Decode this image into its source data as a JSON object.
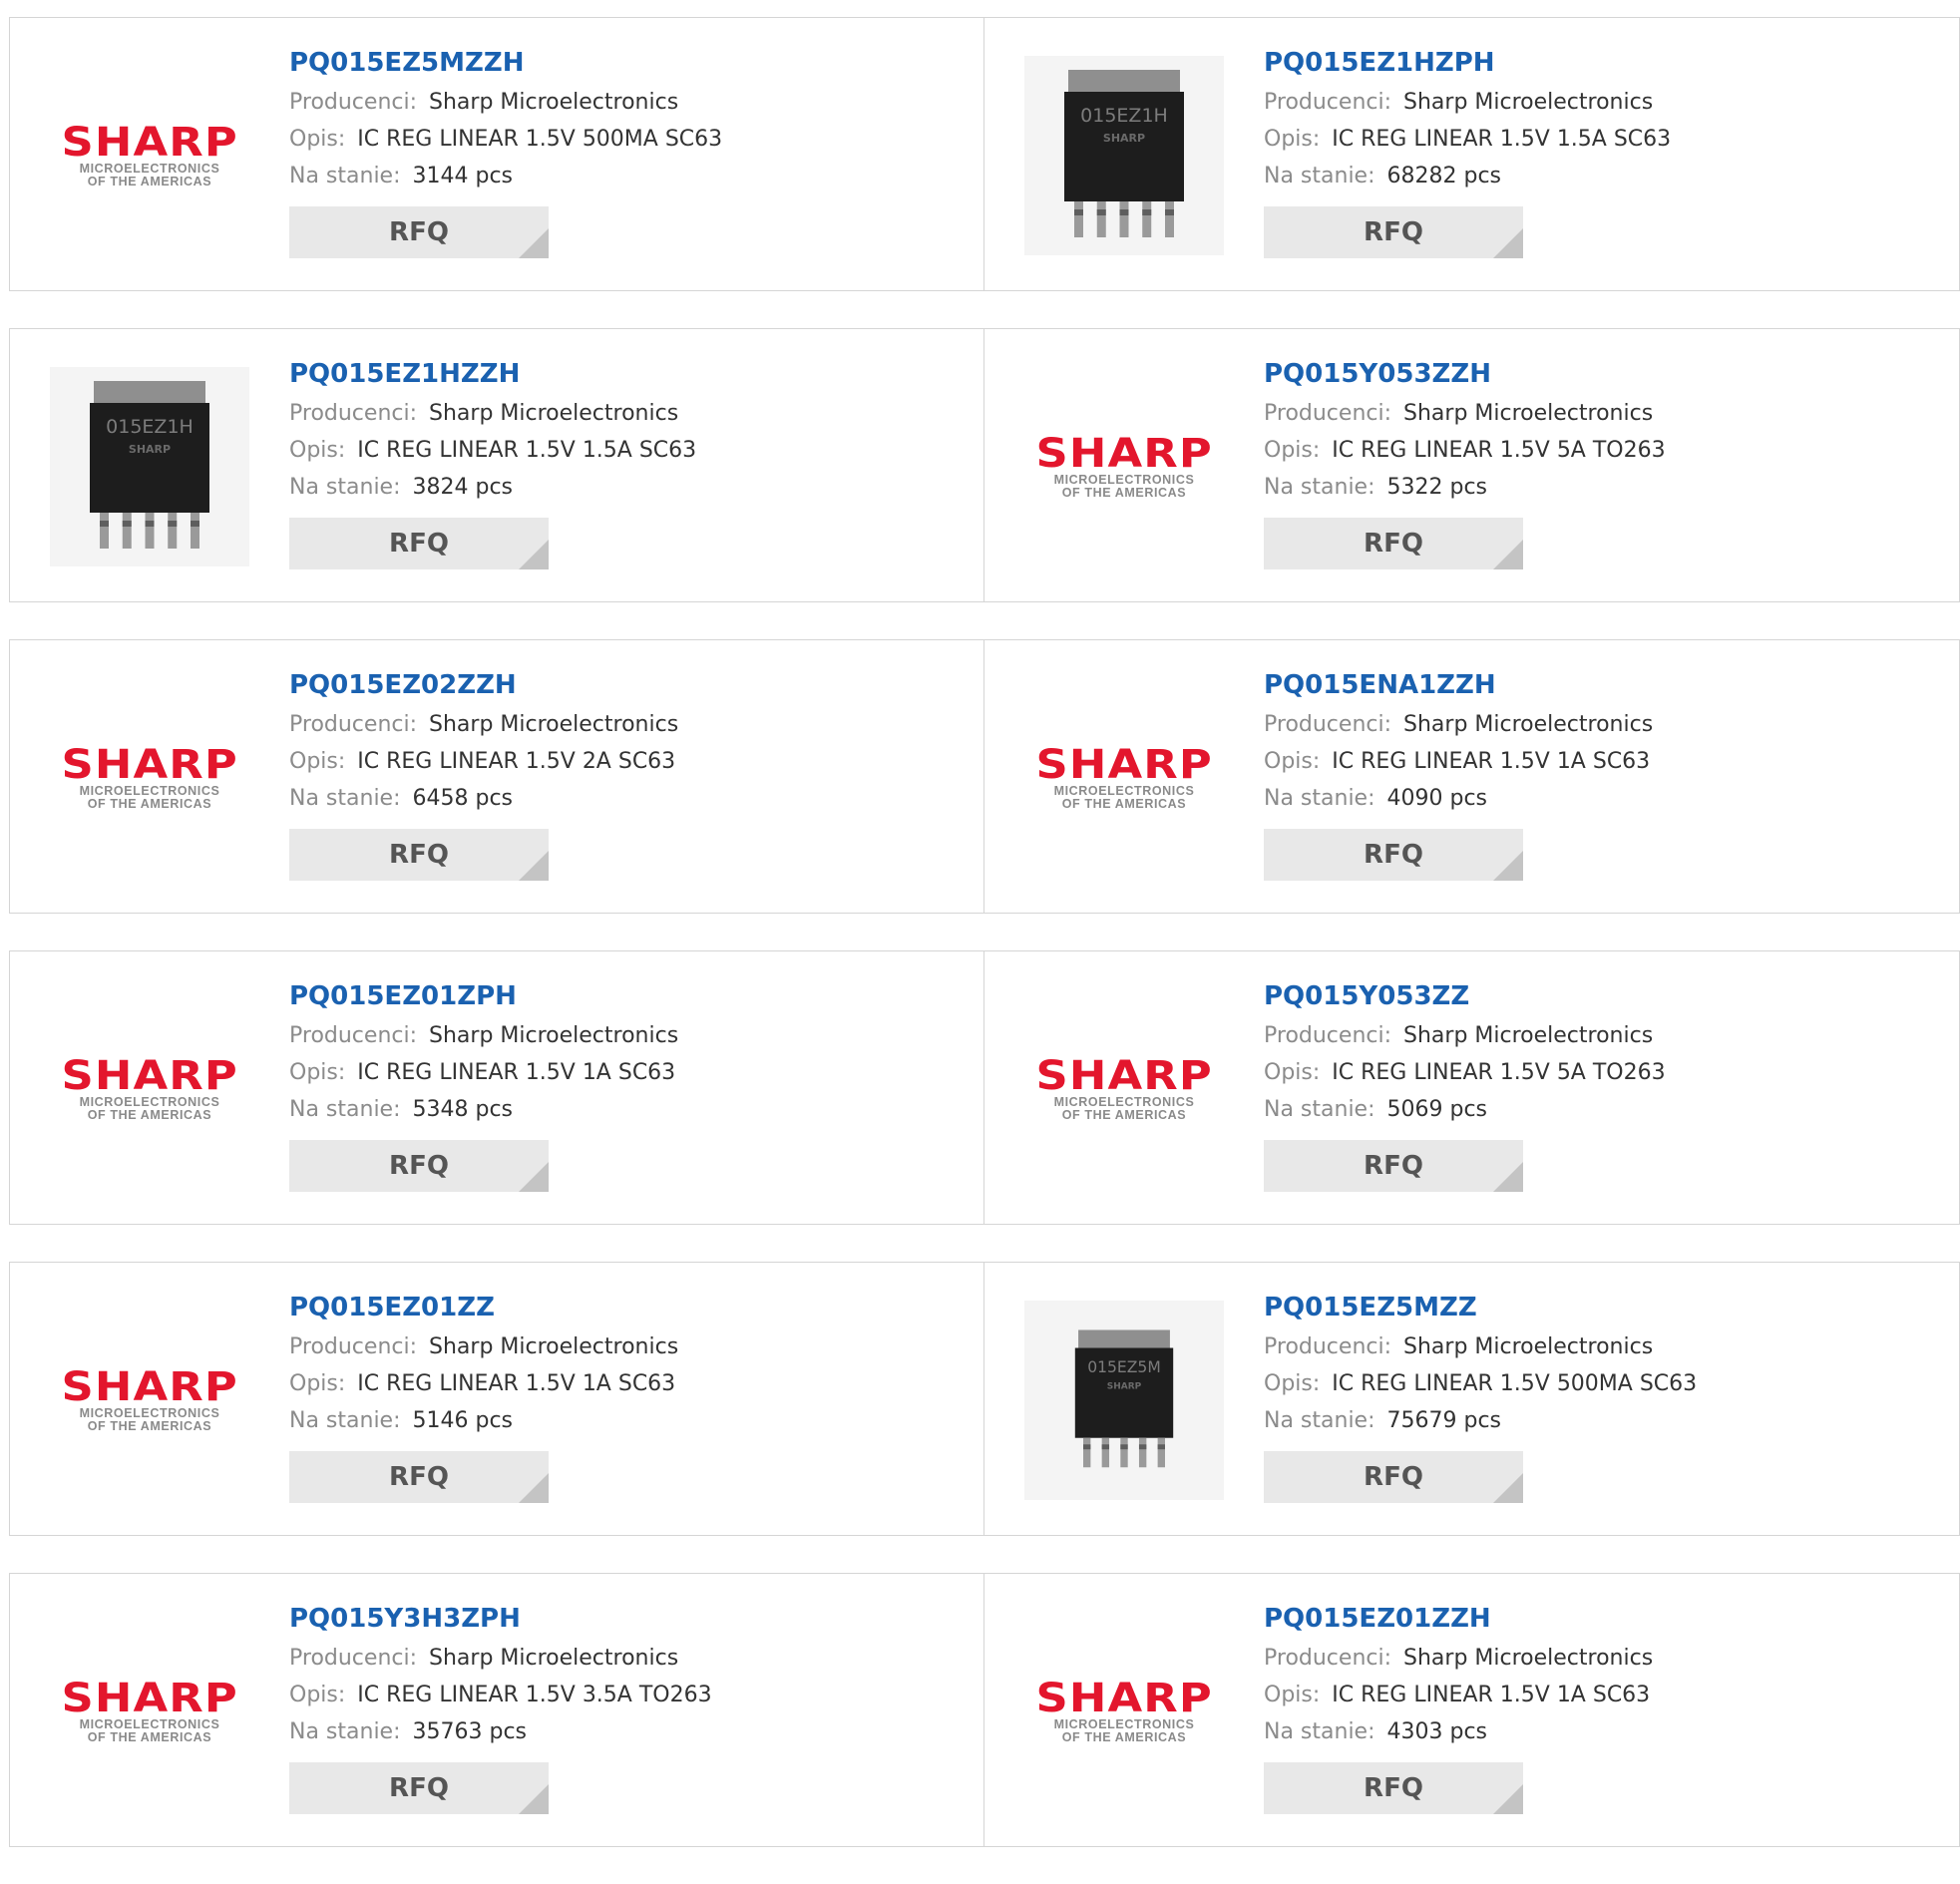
{
  "labels": {
    "manufacturer": "Producenci:",
    "description": "Opis:",
    "stock": "Na stanie:",
    "rfq": "RFQ"
  },
  "logo": {
    "word": "SHARP",
    "line1": "MICROELECTRONICS",
    "line2": "OF THE AMERICAS"
  },
  "colors": {
    "part_link": "#1a61b0",
    "logo_red": "#e3162d",
    "label_gray": "#8b8b8b",
    "button_bg": "#e8e8e8"
  },
  "products": [
    {
      "part": "PQ015EZ5MZZH",
      "manufacturer": "Sharp Microelectronics",
      "description": "IC REG LINEAR 1.5V 500MA SC63",
      "stock": "3144 pcs",
      "image": "logo"
    },
    {
      "part": "PQ015EZ1HZPH",
      "manufacturer": "Sharp Microelectronics",
      "description": "IC REG LINEAR 1.5V 1.5A SC63",
      "stock": "68282 pcs",
      "image": "chip",
      "chip_text": "015EZ1H"
    },
    {
      "part": "PQ015EZ1HZZH",
      "manufacturer": "Sharp Microelectronics",
      "description": "IC REG LINEAR 1.5V 1.5A SC63",
      "stock": "3824 pcs",
      "image": "chip",
      "chip_text": "015EZ1H"
    },
    {
      "part": "PQ015Y053ZZH",
      "manufacturer": "Sharp Microelectronics",
      "description": "IC REG LINEAR 1.5V 5A TO263",
      "stock": "5322 pcs",
      "image": "logo"
    },
    {
      "part": "PQ015EZ02ZZH",
      "manufacturer": "Sharp Microelectronics",
      "description": "IC REG LINEAR 1.5V 2A SC63",
      "stock": "6458 pcs",
      "image": "logo"
    },
    {
      "part": "PQ015ENA1ZZH",
      "manufacturer": "Sharp Microelectronics",
      "description": "IC REG LINEAR 1.5V 1A SC63",
      "stock": "4090 pcs",
      "image": "logo"
    },
    {
      "part": "PQ015EZ01ZPH",
      "manufacturer": "Sharp Microelectronics",
      "description": "IC REG LINEAR 1.5V 1A SC63",
      "stock": "5348 pcs",
      "image": "logo"
    },
    {
      "part": "PQ015Y053ZZ",
      "manufacturer": "Sharp Microelectronics",
      "description": "IC REG LINEAR 1.5V 5A TO263",
      "stock": "5069 pcs",
      "image": "logo"
    },
    {
      "part": "PQ015EZ01ZZ",
      "manufacturer": "Sharp Microelectronics",
      "description": "IC REG LINEAR 1.5V 1A SC63",
      "stock": "5146 pcs",
      "image": "logo"
    },
    {
      "part": "PQ015EZ5MZZ",
      "manufacturer": "Sharp Microelectronics",
      "description": "IC REG LINEAR 1.5V 500MA SC63",
      "stock": "75679 pcs",
      "image": "chip-small",
      "chip_text": "015EZ5M"
    },
    {
      "part": "PQ015Y3H3ZPH",
      "manufacturer": "Sharp Microelectronics",
      "description": "IC REG LINEAR 1.5V 3.5A TO263",
      "stock": "35763 pcs",
      "image": "logo"
    },
    {
      "part": "PQ015EZ01ZZH",
      "manufacturer": "Sharp Microelectronics",
      "description": "IC REG LINEAR 1.5V 1A SC63",
      "stock": "4303 pcs",
      "image": "logo"
    }
  ]
}
